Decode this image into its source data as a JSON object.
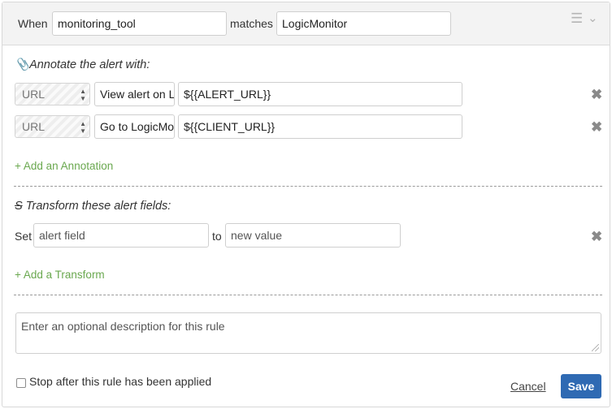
{
  "header": {
    "when_label": "When",
    "field_value": "monitoring_tool",
    "matches_label": "matches",
    "match_value": "LogicMonitor",
    "menu_icon": "hamburger-icon",
    "collapse_icon": "chevron-down-icon"
  },
  "annotate": {
    "title": "Annotate the alert with:",
    "icon": "paperclip-icon",
    "rows": [
      {
        "type": "URL",
        "label": "View alert on LogicMonitor",
        "value": "${{ALERT_URL}}"
      },
      {
        "type": "URL",
        "label": "Go to LogicMonitor",
        "value": "${{CLIENT_URL}}"
      }
    ],
    "add_link": "+ Add an Annotation"
  },
  "transform": {
    "title": "Transform these alert fields:",
    "icon": "strikethrough-icon",
    "set_label": "Set",
    "field_placeholder": "alert field",
    "to_label": "to",
    "value_placeholder": "new value",
    "add_link": "+ Add a Transform"
  },
  "description": {
    "placeholder": "Enter an optional description for this rule"
  },
  "footer": {
    "stop_label": "Stop after this rule has been applied",
    "cancel_label": "Cancel",
    "save_label": "Save"
  },
  "colors": {
    "accent": "#2f6ab3",
    "link_green": "#6aa84f",
    "header_bg": "#f3f3f3"
  }
}
